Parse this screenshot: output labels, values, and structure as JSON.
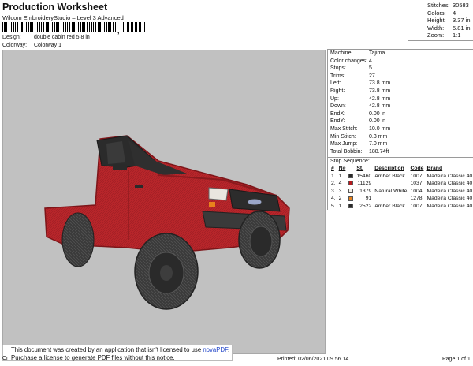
{
  "header": {
    "title": "Production Worksheet",
    "subtitle": "Wilcom EmbroideryStudio – Level 3 Advanced",
    "barcode_sep": ",",
    "design_label": "Design:",
    "design_value": "double cabin red 5,8 in",
    "colorway_label": "Colorway:",
    "colorway_value": "Colorway 1"
  },
  "stats": [
    {
      "label": "Stitches:",
      "value": "30583"
    },
    {
      "label": "Colors:",
      "value": "4"
    },
    {
      "label": "Height:",
      "value": "3.37 in"
    },
    {
      "label": "Width:",
      "value": "5.81 in"
    },
    {
      "label": "Zoom:",
      "value": "1:1"
    }
  ],
  "machine_info": [
    {
      "label": "Machine:",
      "value": "Tajima"
    },
    {
      "label": "Color changes:",
      "value": "4"
    },
    {
      "label": "Stops:",
      "value": "5"
    },
    {
      "label": "Trims:",
      "value": "27"
    },
    {
      "label": "Left:",
      "value": "73.8 mm"
    },
    {
      "label": "Right:",
      "value": "73.8 mm"
    },
    {
      "label": "Up:",
      "value": "42.8 mm"
    },
    {
      "label": "Down:",
      "value": "42.8 mm"
    },
    {
      "label": "EndX:",
      "value": "0.00 in"
    },
    {
      "label": "EndY:",
      "value": "0.00 in"
    },
    {
      "label": "Max Stitch:",
      "value": "10.0 mm"
    },
    {
      "label": "Min Stitch:",
      "value": "0.3 mm"
    },
    {
      "label": "Max Jump:",
      "value": "7.0 mm"
    },
    {
      "label": "Total Bobbin:",
      "value": "188.74ft"
    }
  ],
  "stop_sequence": {
    "title": "Stop Sequence:",
    "headers": [
      "#",
      "N#",
      "",
      "St.",
      "Description",
      "Code",
      "Brand"
    ],
    "rows": [
      {
        "idx": "1.",
        "n": "1",
        "color": "#2a2a2a",
        "st": "15460",
        "desc": "Amber Black",
        "code": "1007",
        "brand": "Madeira Classic 40"
      },
      {
        "idx": "2.",
        "n": "4",
        "color": "#b51a1e",
        "st": "11129",
        "desc": "",
        "code": "1037",
        "brand": "Madeira Classic 40"
      },
      {
        "idx": "3.",
        "n": "3",
        "color": "#f4f1ea",
        "st": "1379",
        "desc": "Natural White",
        "code": "1004",
        "brand": "Madeira Classic 40"
      },
      {
        "idx": "4.",
        "n": "2",
        "color": "#e8821c",
        "st": "91",
        "desc": "",
        "code": "1278",
        "brand": "Madeira Classic 40"
      },
      {
        "idx": "5.",
        "n": "1",
        "color": "#2a2a2a",
        "st": "2522",
        "desc": "Amber Black",
        "code": "1007",
        "brand": "Madeira Classic 40"
      }
    ]
  },
  "notice": {
    "line1_prefix": "This document was created by an application that isn't licensed to use ",
    "link": "novaPDF",
    "line1_suffix": ".",
    "line2": "Purchase a license to generate PDF files without this notice."
  },
  "footer": {
    "left": "Cr",
    "printed": "Printed: 02/06/2021 09.56.14",
    "page": "Page 1 of 1"
  }
}
